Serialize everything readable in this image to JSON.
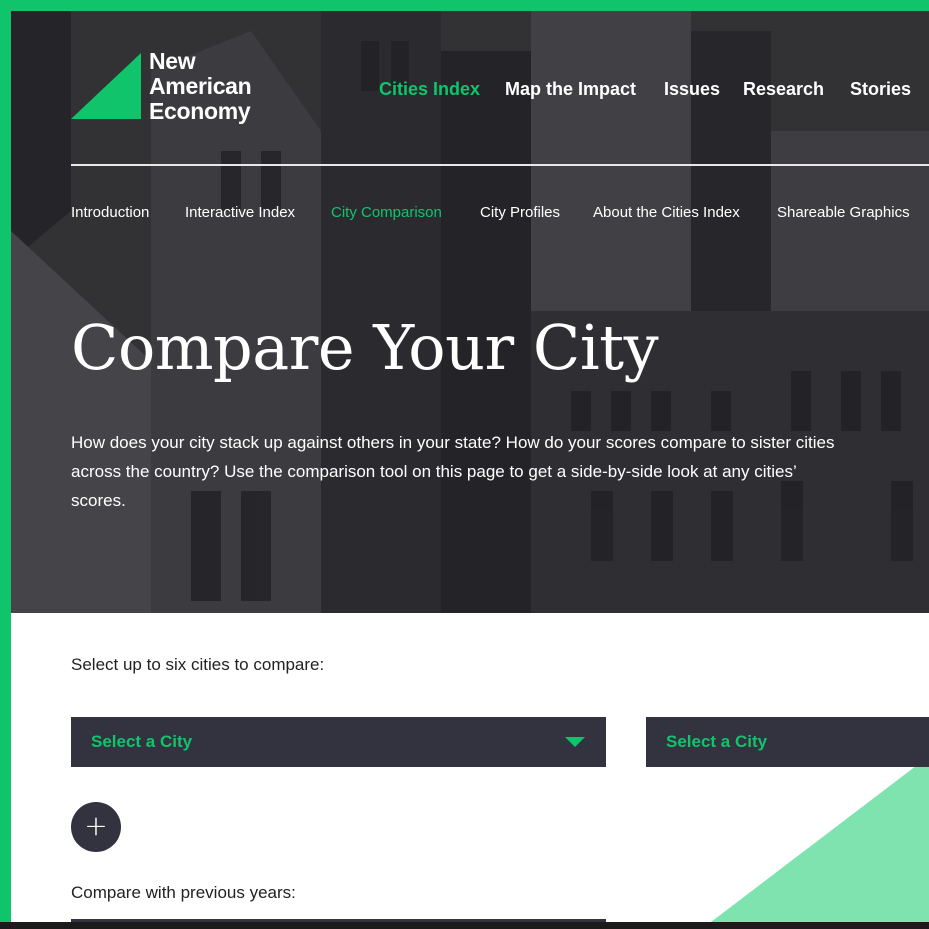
{
  "brand": {
    "line1": "New",
    "line2": "American",
    "line3": "Economy",
    "accent_color": "#10c46c",
    "dark_color": "#33323f"
  },
  "main_nav": [
    "Cities Index",
    "Map the Impact",
    "Issues",
    "Research",
    "Stories"
  ],
  "sub_nav": [
    "Introduction",
    "Interactive Index",
    "City Comparison",
    "City Profiles",
    "About the Cities Index",
    "Shareable Graphics"
  ],
  "hero": {
    "title": "Compare Your City",
    "body": "How does your city stack up against others in your state? How do your scores compare to sister cities across the country? Use the comparison tool on this page to get a side-by-side look at any cities’ scores."
  },
  "compare": {
    "select_label": "Select up to six cities to compare:",
    "select_placeholder_1": "Select a City",
    "select_placeholder_2": "Select a City",
    "add_icon": "+",
    "years_label": "Compare with previous years:"
  }
}
